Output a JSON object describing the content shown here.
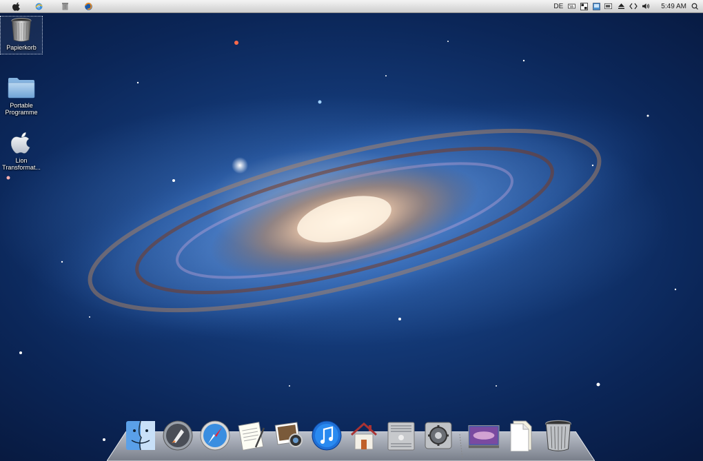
{
  "menubar": {
    "left_icons": [
      {
        "name": "apple-icon"
      },
      {
        "name": "ie-browser-icon"
      },
      {
        "name": "trash-small-icon"
      },
      {
        "name": "firefox-icon"
      }
    ],
    "language": "DE",
    "clock": "5:49 AM",
    "tray_icons": [
      "keyboard-icon",
      "grid-icon",
      "display-icon",
      "battery-icon",
      "eject-icon",
      "code-icon",
      "volume-icon",
      "spotlight-icon"
    ]
  },
  "desktop": {
    "icons": [
      {
        "label": "Papierkorb",
        "icon": "trash-icon",
        "selected": true
      },
      {
        "label": "Portable Programme",
        "icon": "folder-icon",
        "selected": false
      },
      {
        "label": "Lion Transformat...",
        "icon": "apple-logo-icon",
        "selected": false
      }
    ]
  },
  "dock": {
    "items": [
      {
        "name": "finder-icon"
      },
      {
        "name": "launchpad-icon"
      },
      {
        "name": "safari-icon"
      },
      {
        "name": "textedit-icon"
      },
      {
        "name": "iphoto-icon"
      },
      {
        "name": "itunes-icon"
      },
      {
        "name": "home-icon"
      },
      {
        "name": "mac-pro-icon"
      },
      {
        "name": "system-preferences-icon"
      },
      {
        "name": "desktop-folder-icon"
      },
      {
        "name": "documents-icon"
      },
      {
        "name": "dock-trash-icon"
      }
    ]
  },
  "colors": {
    "menubar_top": "#f4f4f4",
    "menubar_bottom": "#cfcfcf",
    "space_blue": "#1d4f9a",
    "galaxy_core": "#ffe6c8"
  }
}
